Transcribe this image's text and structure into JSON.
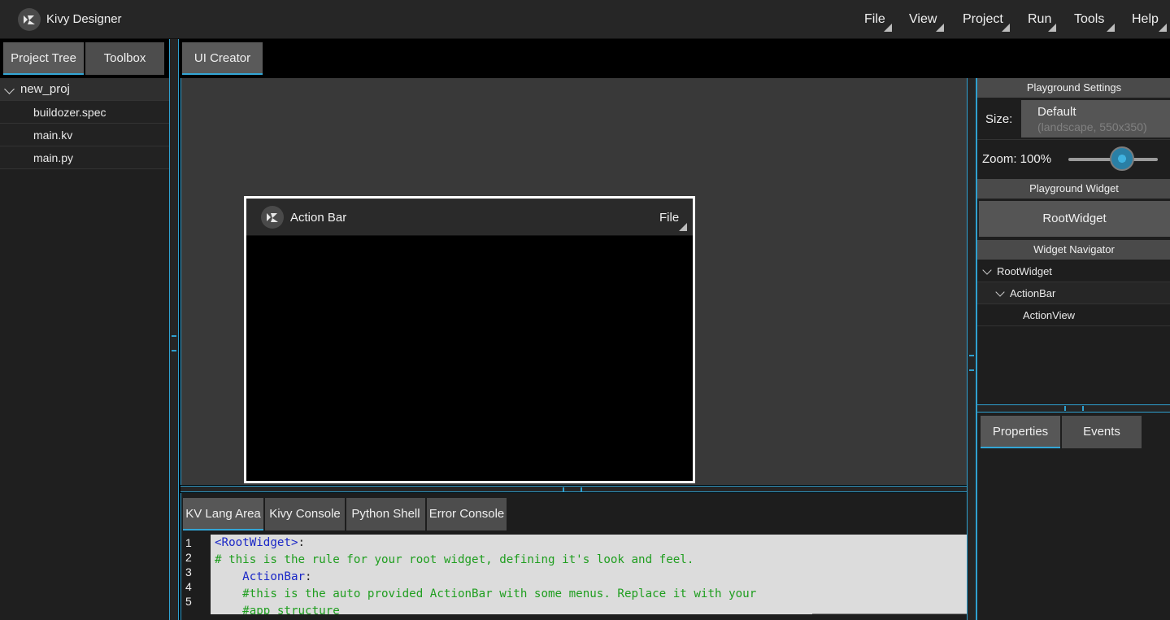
{
  "app": {
    "title": "Kivy Designer"
  },
  "menu": [
    "File",
    "View",
    "Project",
    "Run",
    "Tools",
    "Help"
  ],
  "left_tabs": [
    "Project Tree",
    "Toolbox"
  ],
  "project_tree": {
    "root": "new_proj",
    "files": [
      "buildozer.spec",
      "main.kv",
      "main.py"
    ]
  },
  "center_tabs": [
    "UI Creator"
  ],
  "preview": {
    "title": "Action Bar",
    "menu": "File"
  },
  "bottom_tabs": [
    "KV Lang Area",
    "Kivy Console",
    "Python Shell",
    "Error Console"
  ],
  "editor": {
    "line_numbers": [
      "1",
      "2",
      "3",
      "4",
      "5"
    ],
    "lines": [
      {
        "kw": "<RootWidget>",
        "rest": ":"
      },
      {
        "comment": "# this is the rule for your root widget, defining it's look and feel."
      },
      {
        "indent": "    ",
        "kw": "ActionBar",
        "rest": ":"
      },
      {
        "indent": "    ",
        "comment": "#this is the auto provided ActionBar with some menus. Replace it with your"
      },
      {
        "indent": "    ",
        "comment": "#app structure"
      }
    ]
  },
  "playground_settings": {
    "header": "Playground Settings",
    "size_label": "Size:",
    "size_value": "Default",
    "size_sub": "(landscape, 550x350)",
    "zoom_label": "Zoom: 100%",
    "zoom_level": 0.6
  },
  "playground_widget": {
    "header": "Playground Widget",
    "value": "RootWidget"
  },
  "widget_navigator": {
    "header": "Widget Navigator",
    "items": [
      "RootWidget",
      "ActionBar",
      "ActionView"
    ]
  },
  "right_tabs": [
    "Properties",
    "Events"
  ],
  "colors": {
    "accent": "#33a6d6",
    "keyword": "#1a27c7",
    "comment": "#1f9e1f"
  }
}
